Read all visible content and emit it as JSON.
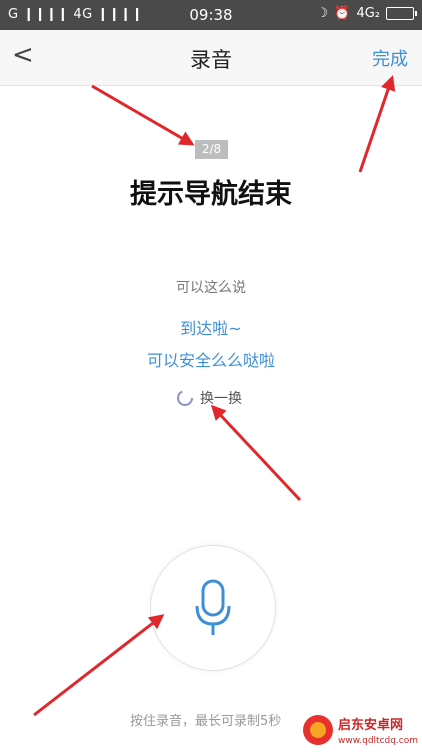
{
  "statusbar": {
    "left": "G ❙❙❙❙ 4G ❙❙❙❙",
    "time": "09:38",
    "right": "4G₂"
  },
  "navbar": {
    "back": "<",
    "title": "录音",
    "done": "完成"
  },
  "progress": {
    "label": "2/8",
    "current": 2,
    "total": 8
  },
  "prompt": {
    "title": "提示导航结束"
  },
  "hint": "可以这么说",
  "phrases": [
    "到达啦~",
    "可以安全么么哒啦"
  ],
  "refresh": {
    "label": "换一换"
  },
  "footer": "按住录音，最长可录制5秒",
  "watermark": {
    "name": "启东安卓网",
    "url": "www.qdltcdq.com"
  },
  "colors": {
    "accent": "#3d8fd6",
    "annotation": "#e0272b"
  }
}
